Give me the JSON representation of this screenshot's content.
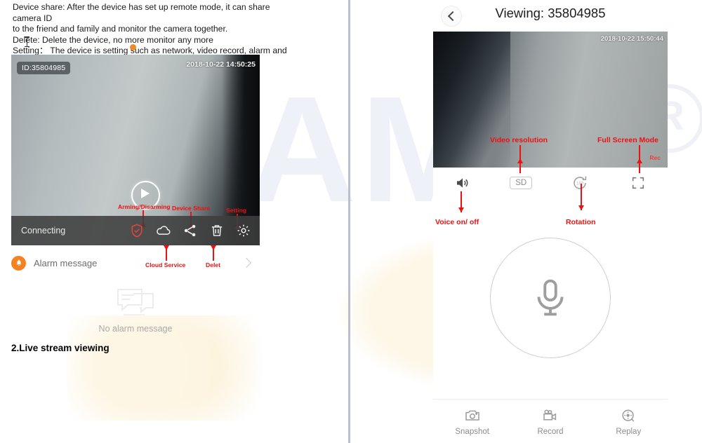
{
  "document": {
    "intro_lines": [
      "Device share: After the device has set up remote mode, it can share camera ID",
      "to the friend and family and monitor the camera together.",
      "Delete: Delete the device, no more monitor any more",
      "Setting： The device is setting such as network, video record, alarm and so on."
    ],
    "section_caption": "2.Live stream viewing",
    "watermark_text": "OCAM",
    "watermark_mark": "R"
  },
  "left_panel": {
    "video": {
      "id_chip": "ID:35804985",
      "timestamp": "2018-10-22  14:50:25",
      "play_icon": "play-icon"
    },
    "status_bar": {
      "status": "Connecting",
      "tools": [
        {
          "name": "arming-disarming",
          "icon": "shield-icon"
        },
        {
          "name": "cloud-service",
          "icon": "cloud-icon"
        },
        {
          "name": "device-share",
          "icon": "share-icon"
        },
        {
          "name": "delete",
          "icon": "trash-icon"
        },
        {
          "name": "setting",
          "icon": "gear-icon"
        }
      ]
    },
    "alarm": {
      "icon": "bell-icon",
      "label": "Alarm message",
      "chevron": "chevron-right-icon",
      "empty_icon": "chat-bubble-icon",
      "empty_text": "No alarm message"
    },
    "annotations": [
      {
        "label": "Arming/Disarming"
      },
      {
        "label": "Device Share"
      },
      {
        "label": "Setting"
      },
      {
        "label": "Cloud Service"
      },
      {
        "label": "Delet"
      }
    ]
  },
  "right_panel": {
    "header": {
      "back_icon": "chevron-left-icon",
      "title": "Viewing:  35804985"
    },
    "video": {
      "timestamp": "2018-10-22  15:50:44",
      "rec_badge": "Rec"
    },
    "controls": [
      {
        "name": "voice",
        "icon": "speaker-icon",
        "label": ""
      },
      {
        "name": "resolution",
        "icon": "sd-badge",
        "label": "SD"
      },
      {
        "name": "rotation",
        "icon": "rotate-icon",
        "label": "180"
      },
      {
        "name": "fullscreen",
        "icon": "fullscreen-icon",
        "label": ""
      }
    ],
    "talk_button": {
      "icon": "microphone-icon"
    },
    "bottom_bar": [
      {
        "name": "snapshot",
        "icon": "camera-icon",
        "label": "Snapshot"
      },
      {
        "name": "record",
        "icon": "video-camera-icon",
        "label": "Record"
      },
      {
        "name": "replay",
        "icon": "replay-icon",
        "label": "Replay"
      }
    ],
    "annotations": [
      {
        "label": "Video resolution"
      },
      {
        "label": "Full Screen Mode"
      },
      {
        "label": "Voice on/ off"
      },
      {
        "label": "Rotation"
      }
    ]
  },
  "colors": {
    "annotation_red": "#ee1111",
    "accent_orange": "#f58220",
    "status_bar": "#3e3e3e"
  }
}
